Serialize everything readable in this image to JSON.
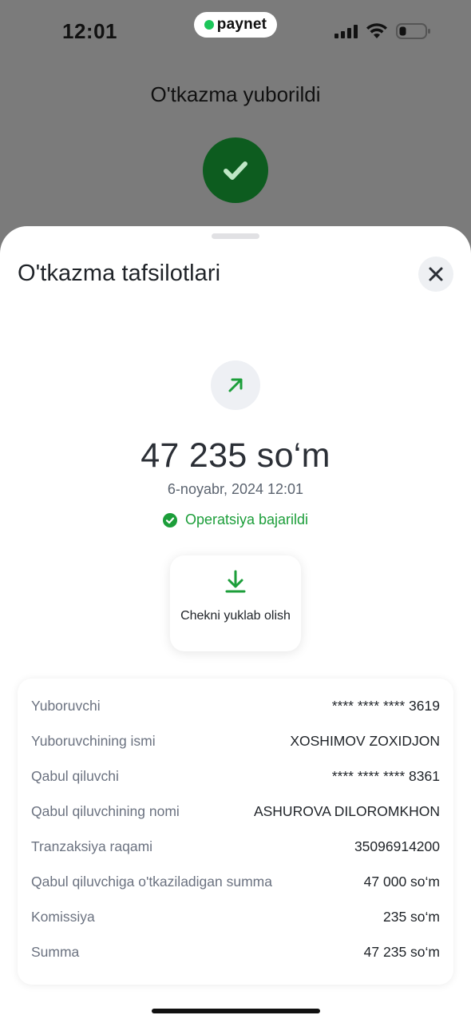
{
  "status_bar": {
    "time": "12:01",
    "brand": "paynet"
  },
  "background": {
    "title": "O'tkazma yuborildi"
  },
  "sheet": {
    "title": "O'tkazma tafsilotlari",
    "amount": "47 235 so‘m",
    "date": "6-noyabr, 2024 12:01",
    "status": "Operatsiya bajarildi",
    "download_label": "Chekni yuklab olish"
  },
  "details": [
    {
      "label": "Yuboruvchi",
      "value": "**** **** **** 3619"
    },
    {
      "label": "Yuboruvchining ismi",
      "value": "XOSHIMOV ZOXIDJON"
    },
    {
      "label": "Qabul qiluvchi",
      "value": "**** **** **** 8361"
    },
    {
      "label": "Qabul qiluvchining nomi",
      "value": "ASHUROVA DILOROMKHON"
    },
    {
      "label": "Tranzaksiya raqami",
      "value": "35096914200"
    },
    {
      "label": "Qabul qiluvchiga o'tkaziladigan summa",
      "value": "47 000 so‘m"
    },
    {
      "label": "Komissiya",
      "value": "235 so‘m"
    },
    {
      "label": "Summa",
      "value": "47 235 so‘m"
    }
  ],
  "colors": {
    "success_green": "#1c9e3a",
    "check_circle_dark_green": "#0d5c1f",
    "brand_green": "#1cc65a"
  },
  "icons": [
    "check-icon",
    "close-icon",
    "arrow-up-right-icon",
    "check-circle-icon",
    "download-icon",
    "signal-icon",
    "wifi-icon",
    "battery-icon"
  ]
}
